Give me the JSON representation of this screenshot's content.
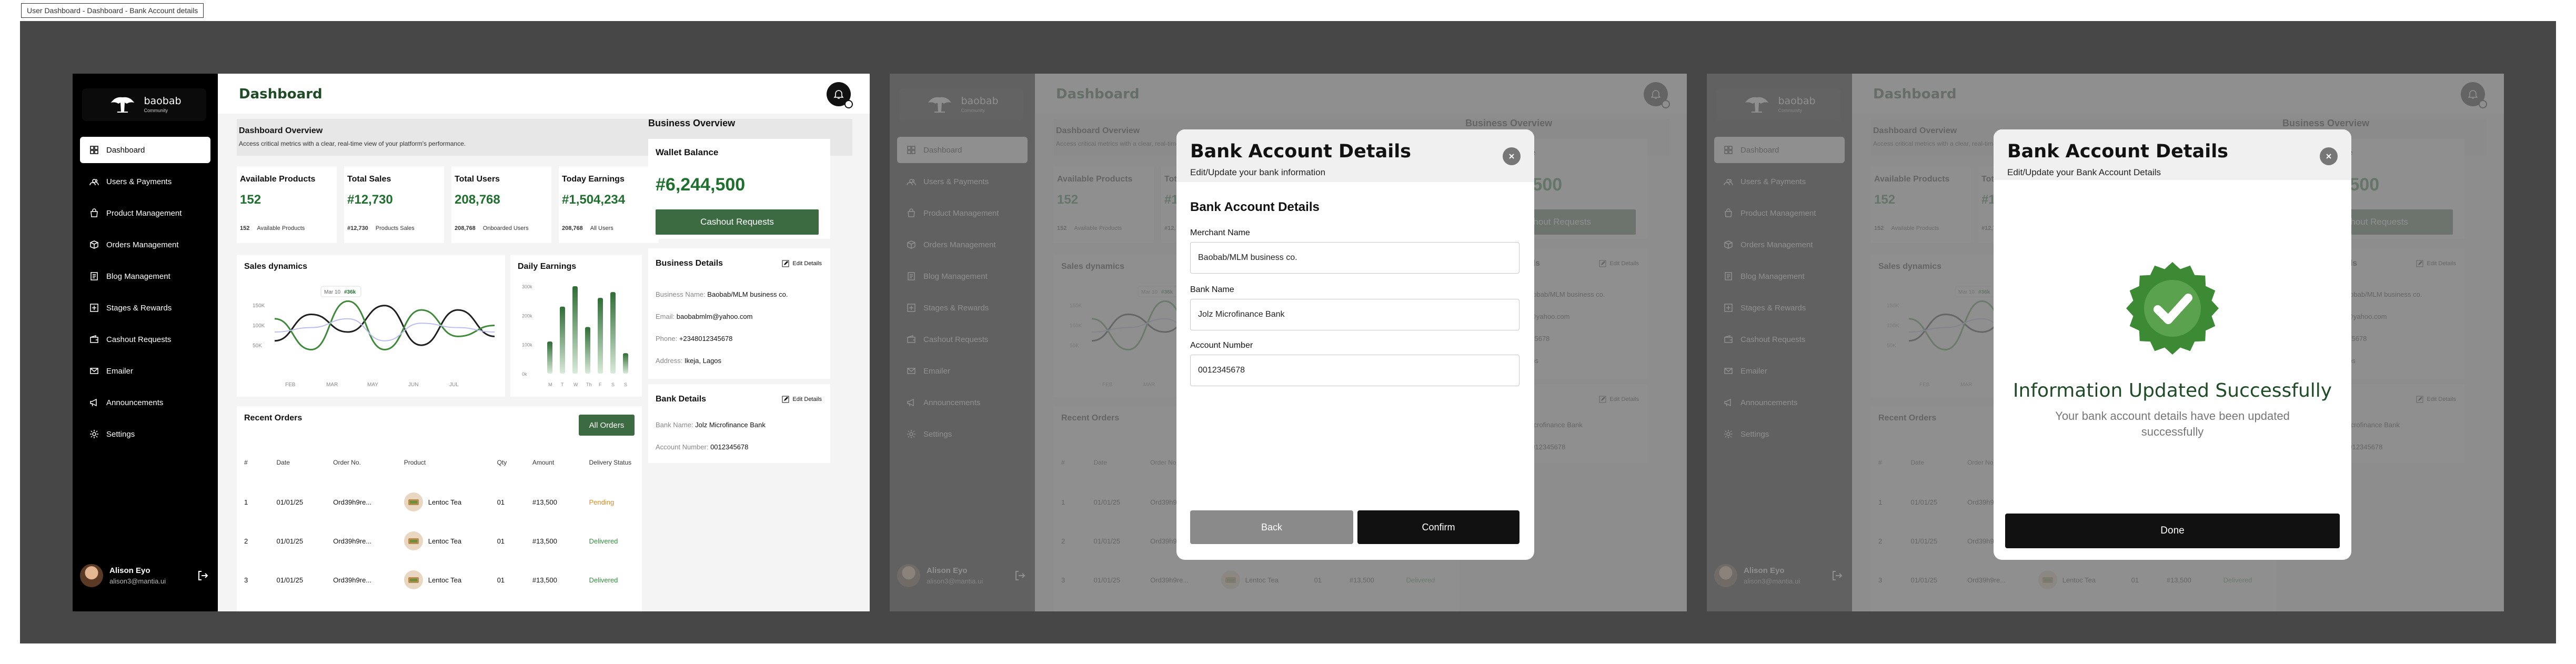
{
  "page_label": "User Dashboard - Dashboard - Bank Account details",
  "colors": {
    "brand_green": "#1f6f2e",
    "button_green": "#3c6b42",
    "sidebar": "#000000",
    "pending": "#e08b24",
    "delivered": "#2f8f3a"
  },
  "brand": {
    "name": "baobab",
    "sub": "Community"
  },
  "sidebar": {
    "items": [
      {
        "label": "Dashboard",
        "icon": "grid-icon",
        "active": true
      },
      {
        "label": "Users & Payments",
        "icon": "users-icon"
      },
      {
        "label": "Product Management",
        "icon": "bag-icon"
      },
      {
        "label": "Orders Management",
        "icon": "box-icon"
      },
      {
        "label": "Blog Management",
        "icon": "blog-icon"
      },
      {
        "label": "Stages & Rewards",
        "icon": "award-icon"
      },
      {
        "label": "Cashout Requests",
        "icon": "wallet-icon"
      },
      {
        "label": "Emailer",
        "icon": "mail-icon"
      },
      {
        "label": "Announcements",
        "icon": "megaphone-icon"
      },
      {
        "label": "Settings",
        "icon": "gear-icon"
      }
    ]
  },
  "user": {
    "name": "Alison Eyo",
    "email": "alison3@mantia.ui"
  },
  "header": {
    "title": "Dashboard"
  },
  "overview": {
    "title": "Dashboard Overview",
    "subtitle": "Access critical metrics with a clear, real-time view of your platform's performance."
  },
  "stats": [
    {
      "label": "Available Products",
      "value": "152",
      "sub_value": "152",
      "sub_label": "Available Products"
    },
    {
      "label": "Total Sales",
      "value": "#12,730",
      "sub_value": "#12,730",
      "sub_label": "Products Sales"
    },
    {
      "label": "Total Users",
      "value": "208,768",
      "sub_value": "208,768",
      "sub_label": "Onboarded Users"
    },
    {
      "label": "Today Earnings",
      "value": "#1,504,234",
      "sub_value": "208,768",
      "sub_label": "All Users"
    }
  ],
  "sales_dynamics": {
    "title": "Sales dynamics",
    "tooltip_label": "Mar 10",
    "tooltip_value": "#36k"
  },
  "daily_earnings": {
    "title": "Daily Earnings"
  },
  "chart_data": [
    {
      "type": "line",
      "title": "Sales dynamics",
      "categories": [
        "FEB",
        "MAR",
        "MAY",
        "JUN",
        "JUL"
      ],
      "yticks": [
        "150K",
        "100K",
        "50K"
      ],
      "series": [
        {
          "color": "#1f1f1f",
          "values": [
            60,
            120,
            80,
            140,
            50,
            130,
            70
          ]
        },
        {
          "color": "#3f8a3a",
          "values": [
            110,
            40,
            150,
            40,
            130,
            70,
            95
          ]
        },
        {
          "color": "#bdbdf0",
          "values": [
            80,
            90,
            110,
            60,
            100,
            90,
            80
          ]
        }
      ],
      "grid": false
    },
    {
      "type": "bar",
      "title": "Daily Earnings",
      "categories": [
        "M",
        "T",
        "W",
        "Th",
        "F",
        "S",
        "S"
      ],
      "yticks": [
        "300k",
        "200k",
        "100k",
        "0k"
      ],
      "values": [
        110,
        230,
        300,
        160,
        260,
        280,
        70
      ],
      "ylim": [
        0,
        300
      ]
    }
  ],
  "orders": {
    "title": "Recent Orders",
    "button": "All Orders",
    "columns": [
      "#",
      "Date",
      "Order No.",
      "Product",
      "Qty",
      "Amount",
      "Delivery Status"
    ],
    "rows": [
      {
        "num": "1",
        "date": "01/01/25",
        "order": "Ord39h9re...",
        "product": "Lentoc Tea",
        "qty": "01",
        "amount": "#13,500",
        "status": "Pending",
        "status_kind": "pending"
      },
      {
        "num": "2",
        "date": "01/01/25",
        "order": "Ord39h9re...",
        "product": "Lentoc Tea",
        "qty": "01",
        "amount": "#13,500",
        "status": "Delivered",
        "status_kind": "delivered"
      },
      {
        "num": "3",
        "date": "01/01/25",
        "order": "Ord39h9re...",
        "product": "Lentoc Tea",
        "qty": "01",
        "amount": "#13,500",
        "status": "Delivered",
        "status_kind": "delivered"
      }
    ]
  },
  "business": {
    "title": "Business Overview",
    "wallet_label": "Wallet Balance",
    "wallet_value": "#6,244,500",
    "cashout_label": "Cashout Requests",
    "details_title": "Business Details",
    "edit_label": "Edit Details",
    "name_label": "Business Name:",
    "name": "Baobab/MLM business co.",
    "email_label": "Email:",
    "email": "baobabmlm@yahoo.com",
    "phone_label": "Phone:",
    "phone": "+2348012345678",
    "address_label": "Address:",
    "address": "Ikeja, Lagos",
    "bank_title": "Bank Details",
    "bank_name_label": "Bank Name:",
    "bank_name": "Jolz Microfinance Bank",
    "account_label": "Account Number:",
    "account": "0012345678"
  },
  "modal_form": {
    "title": "Bank Account Details",
    "subtitle": "Edit/Update your bank information",
    "heading": "Bank Account Details",
    "merchant_label": "Merchant Name",
    "merchant_value": "Baobab/MLM business co.",
    "bank_label": "Bank Name",
    "bank_value": "Jolz Microfinance Bank",
    "account_label": "Account Number",
    "account_value": "0012345678",
    "back": "Back",
    "confirm": "Confirm"
  },
  "modal_success": {
    "title": "Bank Account Details",
    "subtitle": "Edit/Update your Bank Account Details",
    "message": "Information Updated Successfully",
    "detail": "Your bank account details have been updated successfully",
    "done": "Done"
  }
}
